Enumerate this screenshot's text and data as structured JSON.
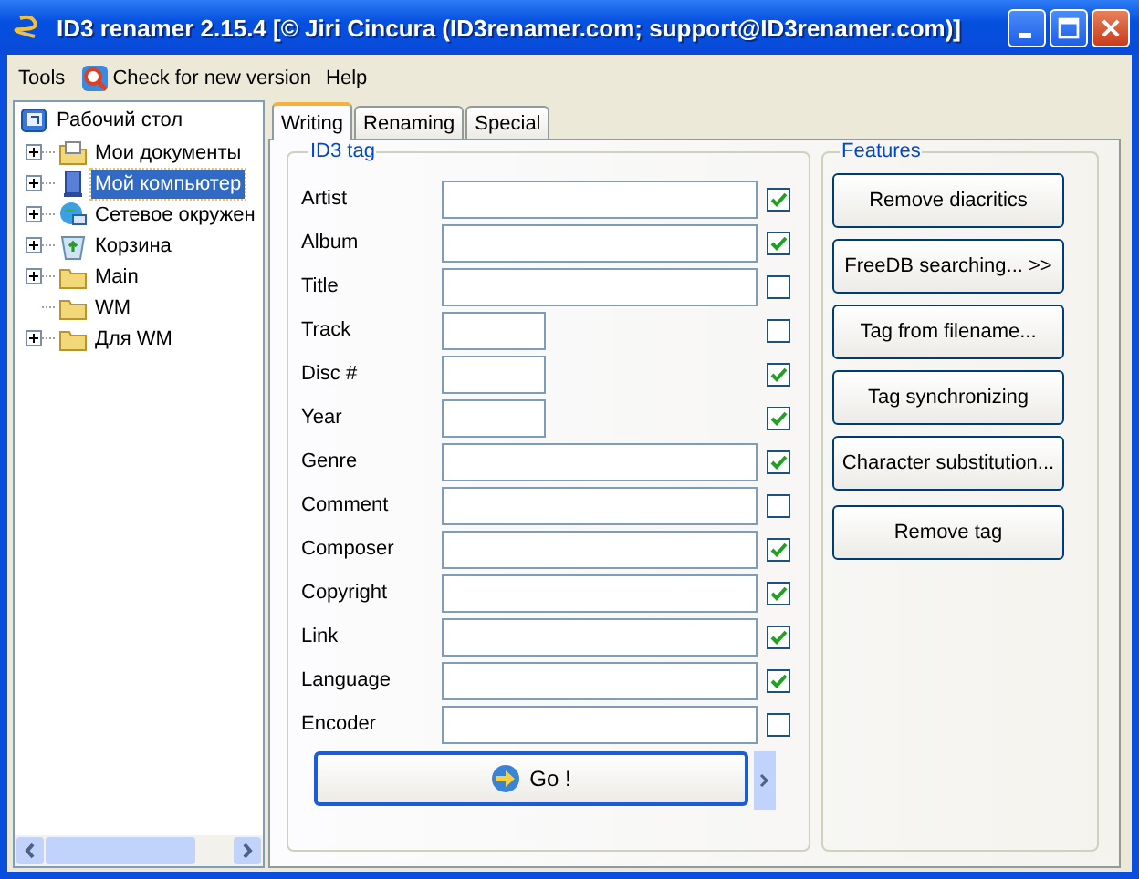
{
  "window": {
    "title": "ID3 renamer 2.15.4 [© Jiri Cincura (ID3renamer.com; support@ID3renamer.com)]"
  },
  "menu": [
    {
      "label": "Tools",
      "kind": "plain"
    },
    {
      "label": "Check for new version",
      "kind": "update"
    },
    {
      "label": "Help",
      "kind": "plain"
    }
  ],
  "tree": {
    "label": "Рабочий стол",
    "kind": "desktop",
    "selected": false,
    "children": [
      {
        "label": "Мои документы",
        "kind": "documents",
        "expandable": true,
        "selected": false
      },
      {
        "label": "Мой компьютер",
        "kind": "computer",
        "expandable": true,
        "selected": true
      },
      {
        "label": "Сетевое окружен",
        "kind": "network",
        "expandable": true,
        "selected": false
      },
      {
        "label": "Корзина",
        "kind": "recycle",
        "expandable": true,
        "selected": false
      },
      {
        "label": "Main",
        "kind": "folder",
        "expandable": true,
        "selected": false
      },
      {
        "label": "WM",
        "kind": "folder",
        "expandable": false,
        "selected": false
      },
      {
        "label": "Для WM",
        "kind": "folder",
        "expandable": true,
        "selected": false
      }
    ]
  },
  "tabs": [
    {
      "label": "Writing",
      "selected": true
    },
    {
      "label": "Renaming",
      "selected": false
    },
    {
      "label": "Special",
      "selected": false
    }
  ],
  "id3_tag": {
    "title": "ID3 tag",
    "fields": [
      {
        "label": "Artist",
        "kind": "long",
        "checked": true
      },
      {
        "label": "Album",
        "kind": "long",
        "checked": true
      },
      {
        "label": "Title",
        "kind": "long",
        "checked": false
      },
      {
        "label": "Track",
        "kind": "short",
        "checked": false
      },
      {
        "label": "Disc #",
        "kind": "short",
        "checked": true
      },
      {
        "label": "Year",
        "kind": "short",
        "checked": true
      },
      {
        "label": "Genre",
        "kind": "long",
        "checked": true
      },
      {
        "label": "Comment",
        "kind": "long",
        "checked": false
      },
      {
        "label": "Composer",
        "kind": "long",
        "checked": true
      },
      {
        "label": "Copyright",
        "kind": "long",
        "checked": true
      },
      {
        "label": "Link",
        "kind": "long",
        "checked": true
      },
      {
        "label": "Language",
        "kind": "long",
        "checked": true
      },
      {
        "label": "Encoder",
        "kind": "long",
        "checked": false
      }
    ],
    "go_button": "Go !"
  },
  "features": {
    "title": "Features",
    "buttons": [
      "Remove diacritics",
      "FreeDB searching... >>",
      "Tag from filename...",
      "Tag synchronizing",
      "Character substitution...",
      "Remove tag"
    ]
  }
}
